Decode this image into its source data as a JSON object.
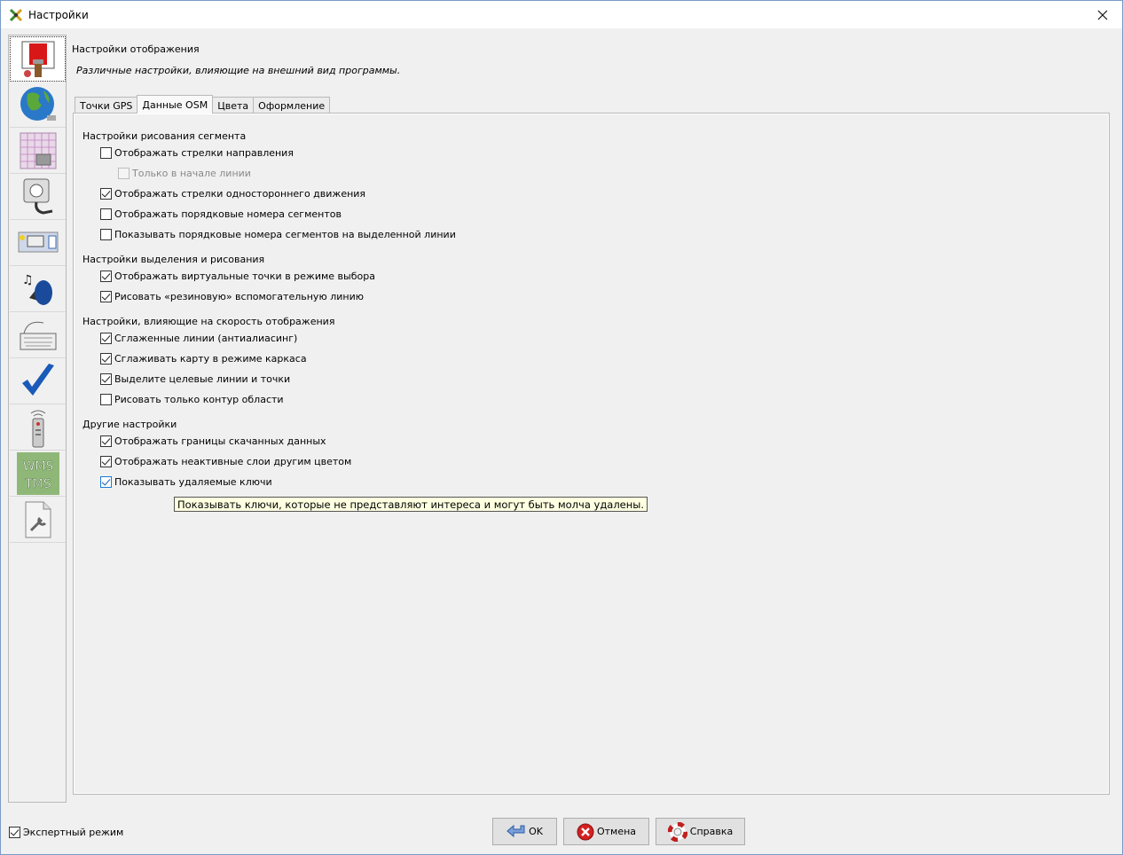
{
  "window": {
    "title": "Настройки"
  },
  "header": {
    "title": "Настройки отображения",
    "subtitle": "Различные настройки, влияющие на внешний вид программы."
  },
  "sidebar": {
    "items": [
      {
        "icon": "display-brush-icon",
        "selected": true
      },
      {
        "icon": "globe-icon"
      },
      {
        "icon": "map-grid-icon"
      },
      {
        "icon": "plugin-icon"
      },
      {
        "icon": "toolbar-icon"
      },
      {
        "icon": "audio-icon"
      },
      {
        "icon": "keyboard-icon"
      },
      {
        "icon": "validator-checkmark-icon"
      },
      {
        "icon": "remote-control-icon"
      },
      {
        "icon": "wms-tms-icon",
        "text": [
          "WMS",
          "TMS"
        ]
      },
      {
        "icon": "advanced-settings-icon"
      }
    ]
  },
  "tabs": [
    {
      "label": "Точки GPS"
    },
    {
      "label": "Данные OSM",
      "active": true
    },
    {
      "label": "Цвета"
    },
    {
      "label": "Оформление"
    }
  ],
  "sections": [
    {
      "title": "Настройки рисования сегмента"
    },
    {
      "title": "Настройки выделения и рисования"
    },
    {
      "title": "Настройки, влияющие на скорость отображения"
    },
    {
      "title": "Другие настройки"
    }
  ],
  "options": [
    {
      "label": "Отображать стрелки направления",
      "checked": false
    },
    {
      "label": "Только в начале линии",
      "checked": false,
      "disabled": true
    },
    {
      "label": "Отображать стрелки одностороннего движения",
      "checked": true
    },
    {
      "label": "Отображать порядковые номера сегментов",
      "checked": false
    },
    {
      "label": "Показывать порядковые номера сегментов на выделенной линии",
      "checked": false
    },
    {
      "label": "Отображать виртуальные точки в режиме выбора",
      "checked": true
    },
    {
      "label": "Рисовать «резиновую» вспомогательную линию",
      "checked": true
    },
    {
      "label": "Сглаженные линии (антиалиасинг)",
      "checked": true
    },
    {
      "label": "Сглаживать карту в режиме каркаса",
      "checked": true
    },
    {
      "label": "Выделите целевые линии и точки",
      "checked": true
    },
    {
      "label": "Рисовать только контур области",
      "checked": false
    },
    {
      "label": "Отображать границы скачанных данных",
      "checked": true
    },
    {
      "label": "Отображать неактивные слои другим цветом",
      "checked": true
    },
    {
      "label": "Показывать удаляемые ключи",
      "checked": true,
      "hovered": true
    }
  ],
  "tooltip": "Показывать ключи, которые не представляют интереса и могут быть молча удалены.",
  "footer": {
    "expert_mode": {
      "label": "Экспертный режим",
      "checked": true
    },
    "ok_label": "OK",
    "cancel_label": "Отмена",
    "help_label": "Справка"
  }
}
